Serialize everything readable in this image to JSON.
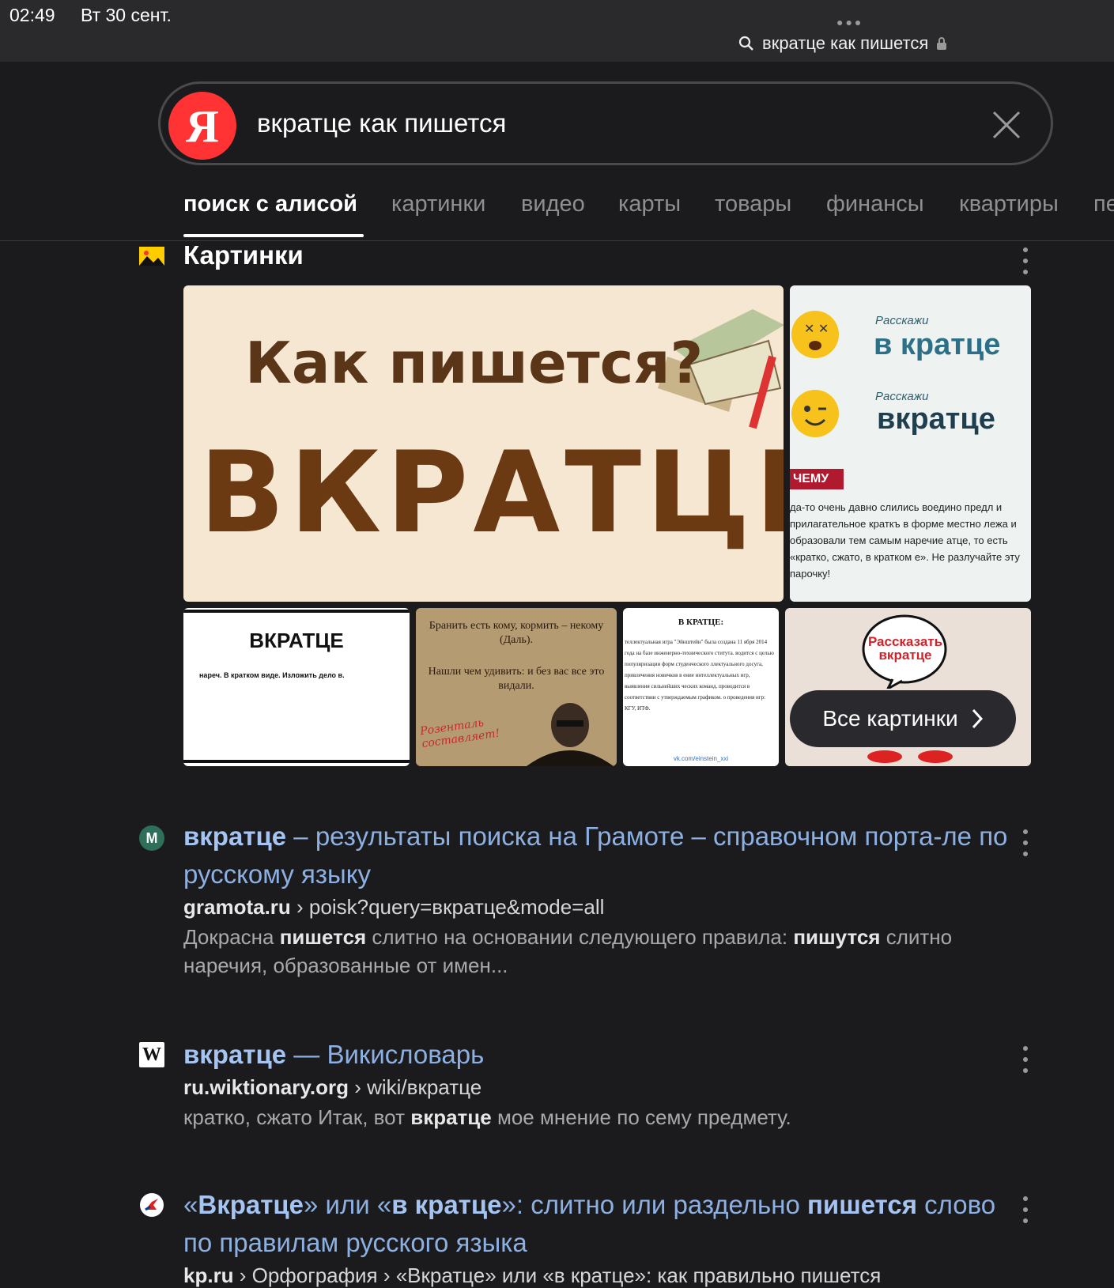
{
  "status": {
    "time": "02:49",
    "date": "Вт 30 сент.",
    "url_text": "вкратце как пишется"
  },
  "search": {
    "query": "вкратце как пишется",
    "logo_letter": "Я"
  },
  "tabs": [
    "поиск с алисой",
    "картинки",
    "видео",
    "карты",
    "товары",
    "финансы",
    "квартиры",
    "пе"
  ],
  "images_section": {
    "title": "Картинки",
    "all_images_label": "Все картинки",
    "img1": {
      "line1": "Как пишется?",
      "line2": "ВКРАТЦЕ"
    },
    "img2": {
      "small1": "Расскажи",
      "big1": "в кратце",
      "small2": "Расскажи",
      "big2": "вкратце",
      "tag": "ЧЕМУ",
      "text": "да-то очень давно слились воедино предл и прилагательное краткъ в форме местно лежа и образовали тем самым наречие атце, то есть «кратко, сжато, в кратком е». Не разлучайте эту парочку!"
    },
    "img3": {
      "title": "ВКРАТЦЕ",
      "text": "нареч. В кратком виде. Изложить дело в."
    },
    "img4": {
      "text1": "Бранить есть кому, кормить – некому (Даль).",
      "text2": "Нашли чем удивить: и без вас все это видали.",
      "script": "Розенталь составляет!"
    },
    "img5": {
      "title": "В КРАТЦЕ:",
      "text": "теллектуальная игра \"Эйнштейн\" была создана 11 ября 2014 года на базе инженерно-технического ститута. водится с целью популяризации форм студенческого ллектуального досуга, привлечения новичков в ение интеллектуальных игр, выявления сильнейших ческих команд. проводится в соответствии с утверждаемым графиком. о проведения игр: КГУ, ИТФ.",
      "footer": "vk.com/einstein_xxi"
    },
    "img6": {
      "bubble": "Рассказать вкратце"
    }
  },
  "results": [
    {
      "title_bold": "вкратце",
      "title_rest": " – результаты поиска на Грамоте – справочном порта-ле по русскому языку",
      "domain": "gramota.ru",
      "path": " › poisk?query=вкратце&mode=all",
      "snippet_parts": [
        "Докрасна ",
        "пишется",
        " слитно на основании следующего правила: ",
        "пишутся",
        " слитно наречия, образованные от имен..."
      ],
      "icon_letter": "M"
    },
    {
      "title_bold": "вкратце",
      "title_rest": " — Викисловарь",
      "domain": "ru.wiktionary.org",
      "path": " › wiki/вкратце",
      "snippet_parts": [
        "кратко, сжато Итак, вот ",
        "вкратце",
        " мое мнение по сему предмету."
      ],
      "icon_letter": "W"
    },
    {
      "title_p1": "«",
      "title_b1": "Вкратце",
      "title_p2": "» или «",
      "title_b2": "в кратце",
      "title_p3": "»: слитно или раздельно ",
      "title_b3": "пишется",
      "title_p4": " слово по правилам русского языка",
      "domain": "kp.ru",
      "path": " › Орфография › «Вкратце» или «в кратце»: как правильно пишется"
    }
  ],
  "colors": {
    "bg": "#1b1b1d",
    "link": "#8db0e2",
    "yandex_red": "#ff3333"
  }
}
